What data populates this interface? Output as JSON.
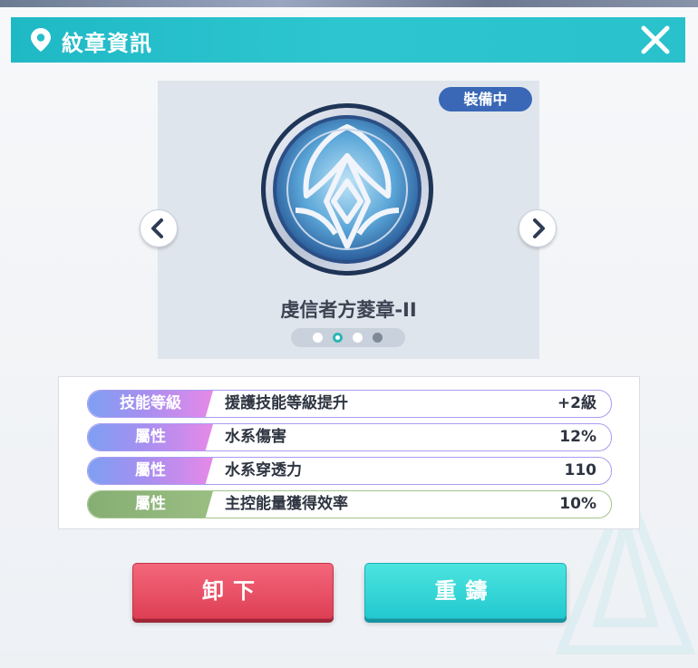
{
  "header": {
    "title": "紋章資訊"
  },
  "card": {
    "status_badge": "裝備中",
    "medal_name": "虔信者方菱章-II",
    "pager": {
      "count": 4,
      "active": 2
    }
  },
  "stats": [
    {
      "tag": "技能等級",
      "name": "援護技能等級提升",
      "value": "+2級",
      "style": "pink"
    },
    {
      "tag": "屬性",
      "name": "水系傷害",
      "value": "12%",
      "style": "pink"
    },
    {
      "tag": "屬性",
      "name": "水系穿透力",
      "value": "110",
      "style": "pink"
    },
    {
      "tag": "屬性",
      "name": "主控能量獲得效率",
      "value": "10%",
      "style": "green"
    }
  ],
  "actions": {
    "unequip": "卸下",
    "recast": "重鑄"
  },
  "colors": {
    "title_bar": "#2dc6d0",
    "badge": "#3a68b7",
    "unequip": "#e04a5f",
    "recast": "#2fd4d6",
    "pager_active": "#2bb5b5"
  },
  "icons": [
    "location-pin-icon",
    "close-icon",
    "chevron-left-icon",
    "chevron-right-icon",
    "medal-emblem"
  ]
}
